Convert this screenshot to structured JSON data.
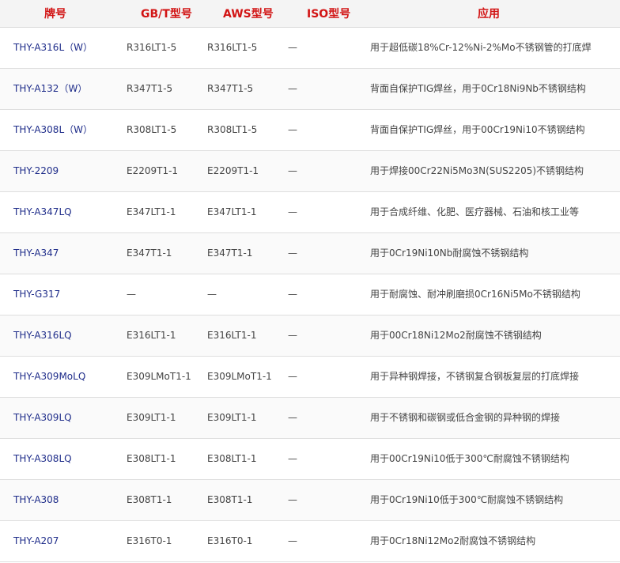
{
  "header": {
    "brand": "牌号",
    "gbt": "GB/T型号",
    "aws": "AWS型号",
    "iso": "ISO型号",
    "application": "应用"
  },
  "rows": [
    {
      "brand": "THY-A316L（W）",
      "gbt": "R316LT1-5",
      "aws": "R316LT1-5",
      "iso": "—",
      "application": "用于超低碳18%Cr-12%Ni-2%Mo不锈钢管的打底焊"
    },
    {
      "brand": "THY-A132（W）",
      "gbt": "R347T1-5",
      "aws": "R347T1-5",
      "iso": "—",
      "application": "背面自保护TIG焊丝，用于0Cr18Ni9Nb不锈钢结构"
    },
    {
      "brand": "THY-A308L（W）",
      "gbt": "R308LT1-5",
      "aws": "R308LT1-5",
      "iso": "—",
      "application": "背面自保护TIG焊丝，用于00Cr19Ni10不锈钢结构"
    },
    {
      "brand": "THY-2209",
      "gbt": "E2209T1-1",
      "aws": "E2209T1-1",
      "iso": "—",
      "application": "用于焊接00Cr22Ni5Mo3N(SUS2205)不锈钢结构"
    },
    {
      "brand": "THY-A347LQ",
      "gbt": "E347LT1-1",
      "aws": "E347LT1-1",
      "iso": "—",
      "application": "用于合成纤维、化肥、医疗器械、石油和核工业等"
    },
    {
      "brand": "THY-A347",
      "gbt": "E347T1-1",
      "aws": "E347T1-1",
      "iso": "—",
      "application": "用于0Cr19Ni10Nb耐腐蚀不锈钢结构"
    },
    {
      "brand": "THY-G317",
      "gbt": "—",
      "aws": "—",
      "iso": "—",
      "application": "用于耐腐蚀、耐冲刷磨损0Cr16Ni5Mo不锈钢结构"
    },
    {
      "brand": "THY-A316LQ",
      "gbt": "E316LT1-1",
      "aws": "E316LT1-1",
      "iso": "—",
      "application": "用于00Cr18Ni12Mo2耐腐蚀不锈钢结构"
    },
    {
      "brand": "THY-A309MoLQ",
      "gbt": "E309LMoT1-1",
      "aws": "E309LMoT1-1",
      "iso": "—",
      "application": "用于异种钢焊接，不锈钢复合钢板复层的打底焊接"
    },
    {
      "brand": "THY-A309LQ",
      "gbt": "E309LT1-1",
      "aws": "E309LT1-1",
      "iso": "—",
      "application": "用于不锈钢和碳钢或低合金钢的异种钢的焊接"
    },
    {
      "brand": "THY-A308LQ",
      "gbt": "E308LT1-1",
      "aws": "E308LT1-1",
      "iso": "—",
      "application": "用于00Cr19Ni10低于300℃耐腐蚀不锈钢结构"
    },
    {
      "brand": "THY-A308",
      "gbt": "E308T1-1",
      "aws": "E308T1-1",
      "iso": "—",
      "application": "用于0Cr19Ni10低于300℃耐腐蚀不锈钢结构"
    },
    {
      "brand": "THY-A207",
      "gbt": "E316T0-1",
      "aws": "E316T0-1",
      "iso": "—",
      "application": "用于0Cr18Ni12Mo2耐腐蚀不锈钢结构"
    }
  ]
}
